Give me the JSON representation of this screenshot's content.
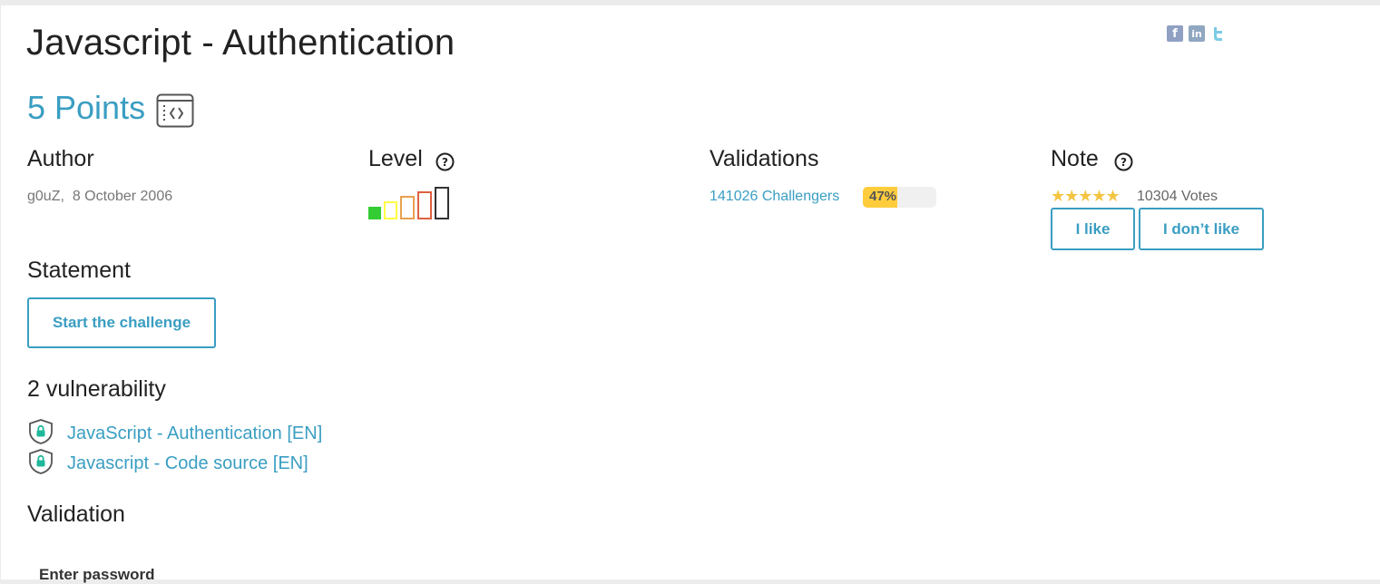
{
  "challenge": {
    "title": "Javascript - Authentication",
    "points": "5 Points",
    "category_icon": "web-client-code-icon"
  },
  "social": {
    "facebook": "f",
    "linkedin": "in",
    "twitter": "t"
  },
  "author": {
    "heading": "Author",
    "name": "g0uZ",
    "date": "8 October 2006"
  },
  "level": {
    "heading": "Level",
    "help_icon": "?",
    "current_level": 1,
    "max_level": 5,
    "colors": [
      "#33cc33",
      "#ffff44",
      "#e8a050",
      "#e06040",
      "#333333"
    ]
  },
  "validations": {
    "heading": "Validations",
    "challengers": "141026 Challengers",
    "percent_label": "47%",
    "percent_value": 0.47,
    "bar_color": "#ffcd3c"
  },
  "note": {
    "heading": "Note",
    "help_icon": "?",
    "stars": "★★★★★",
    "rating": 5,
    "votes": "10304 Votes",
    "like_label": "I like",
    "dislike_label": "I don’t like"
  },
  "statement": {
    "heading": "Statement",
    "start_label": "Start the challenge"
  },
  "vulnerabilities": {
    "heading": "2 vulnerability",
    "items": [
      {
        "label": "JavaScript - Authentication [EN]"
      },
      {
        "label": "Javascript - Code source [EN]"
      }
    ]
  },
  "validation": {
    "heading": "Validation",
    "password_label": "Enter password"
  },
  "colors": {
    "accent": "#3a9ec2",
    "lock": "#1fb89a"
  }
}
